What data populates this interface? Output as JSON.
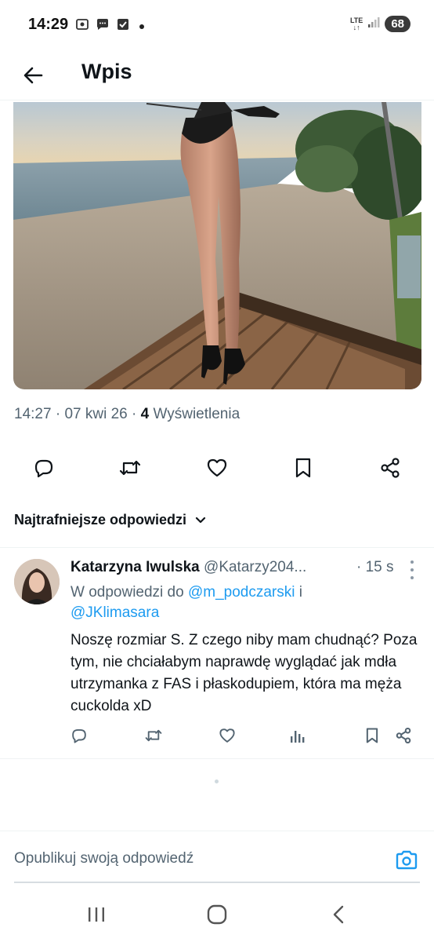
{
  "status_bar": {
    "time": "14:29",
    "network": "LTE",
    "battery": "68"
  },
  "header": {
    "title": "Wpis"
  },
  "post": {
    "time": "14:27",
    "date": "07 kwi 26",
    "views_count": "4",
    "views_label": "Wyświetlenia",
    "image_icon": "beach-photo"
  },
  "actions": [
    "reply-icon",
    "retweet-icon",
    "like-icon",
    "bookmark-icon",
    "share-icon"
  ],
  "replies_sort": {
    "label": "Najtrafniejsze odpowiedzi"
  },
  "reply": {
    "name": "Katarzyna Iwulska",
    "handle": "@Katarzy204...",
    "time": "· 15 s",
    "replying_prefix": "W odpowiedzi do",
    "replying_user1": "@m_podczarski",
    "replying_and": "i",
    "replying_user2": "@JKlimasara",
    "text": "Noszę rozmiar S. Z czego niby mam chudnąć? Poza tym, nie chciałabym naprawdę wyglądać jak mdła utrzymanka z FAS i płaskodupiem, która ma męża cuckolda xD"
  },
  "composer": {
    "placeholder": "Opublikuj swoją odpowiedź"
  },
  "colors": {
    "accent": "#1d9bf0",
    "text": "#0f1419",
    "muted": "#536471"
  }
}
